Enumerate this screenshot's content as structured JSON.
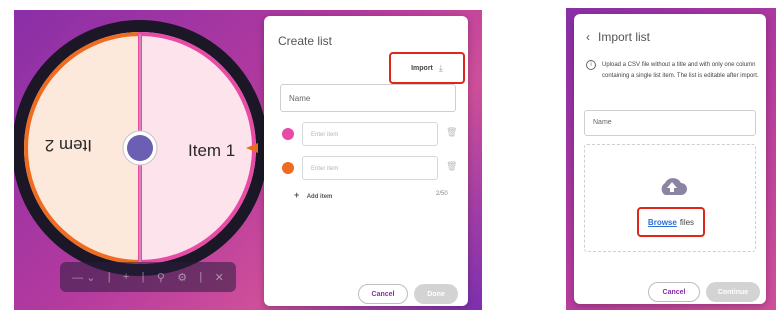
{
  "left_view": {
    "wheel": {
      "items": [
        {
          "label": "Item 1",
          "side": "right",
          "slice_color": "#fde3ec",
          "border_color": "#e84ba5"
        },
        {
          "label": "Item 2",
          "side": "left",
          "slice_color": "#fde9dc",
          "border_color": "#ef6b1f"
        }
      ],
      "rim_color": "#1c1726",
      "pointer_color": "#ef6b1f"
    },
    "toolbar": {
      "icons": [
        "dropdown-icon",
        "add-icon",
        "search-icon",
        "settings-icon",
        "close-icon"
      ]
    },
    "create_list": {
      "title": "Create list",
      "import_label": "Import",
      "name_placeholder": "Name",
      "items": [
        {
          "placeholder": "Enter item",
          "color": "#e84ba5"
        },
        {
          "placeholder": "Enter item",
          "color": "#ef6b1f"
        }
      ],
      "add_item_label": "Add item",
      "counter": "2/50",
      "cancel_label": "Cancel",
      "done_label": "Done"
    }
  },
  "right_view": {
    "import_list": {
      "back_icon": "chevron-left-icon",
      "title": "Import list",
      "info_text": "Upload a CSV file without a title and with only one column containing a single list item. The list is editable after import.",
      "name_placeholder": "Name",
      "browse_label": "Browse",
      "files_label": "files",
      "cancel_label": "Cancel",
      "continue_label": "Continue"
    }
  },
  "colors": {
    "background_purple": "#8a2fa8",
    "highlight_red": "#e0261b",
    "link_blue": "#2f6fd6"
  }
}
